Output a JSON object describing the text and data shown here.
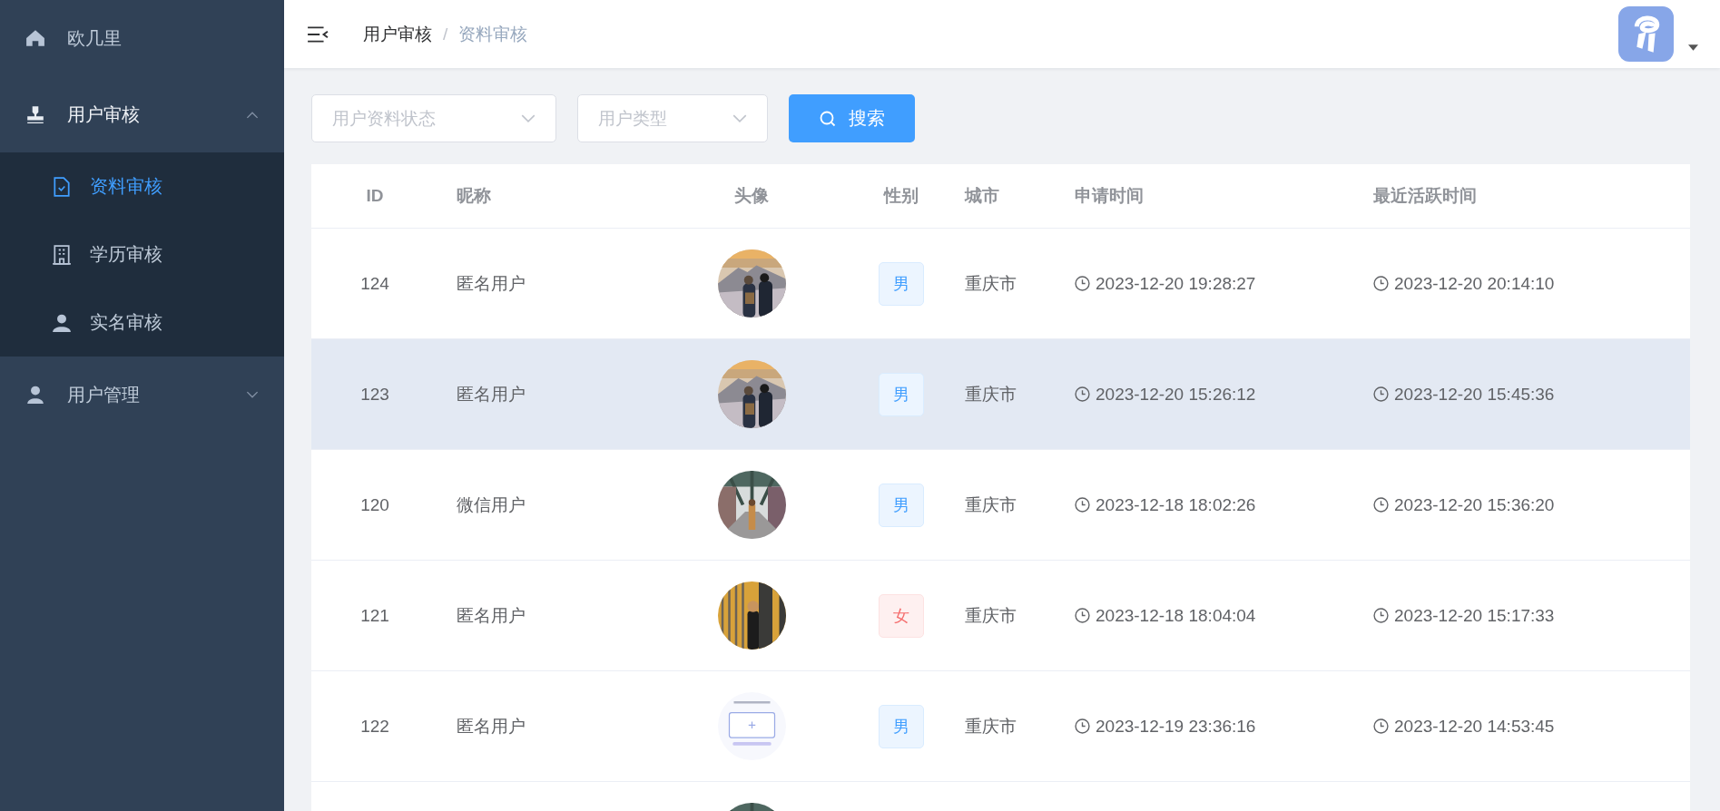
{
  "sidebar": {
    "items": [
      {
        "label": "欧几里"
      },
      {
        "label": "用户审核",
        "expanded": true,
        "children": [
          {
            "label": "资料审核",
            "selected": true
          },
          {
            "label": "学历审核",
            "selected": false
          },
          {
            "label": "实名审核",
            "selected": false
          }
        ]
      },
      {
        "label": "用户管理",
        "expanded": false
      }
    ]
  },
  "header": {
    "breadcrumb": [
      {
        "label": "用户审核",
        "current": false
      },
      {
        "label": "资料审核",
        "current": true
      }
    ],
    "separator": "/"
  },
  "filters": {
    "selects": [
      {
        "placeholder": "用户资料状态"
      },
      {
        "placeholder": "用户类型"
      }
    ],
    "search_button": "搜索"
  },
  "table": {
    "columns": [
      "ID",
      "昵称",
      "头像",
      "性别",
      "城市",
      "申请时间",
      "最近活跃时间"
    ],
    "rows": [
      {
        "id": "124",
        "nickname": "匿名用户",
        "gender": "男",
        "color": "#409eff",
        "city": "重庆市",
        "applied": "2023-12-20 19:28:27",
        "active": "2023-12-20 20:14:10",
        "selected": false
      },
      {
        "id": "123",
        "nickname": "匿名用户",
        "gender": "男",
        "color": "#409eff",
        "city": "重庆市",
        "applied": "2023-12-20 15:26:12",
        "active": "2023-12-20 15:45:36",
        "selected": true
      },
      {
        "id": "120",
        "nickname": "微信用户",
        "gender": "男",
        "color": "#409eff",
        "city": "重庆市",
        "applied": "2023-12-18 18:02:26",
        "active": "2023-12-20 15:36:20",
        "selected": false
      },
      {
        "id": "121",
        "nickname": "匿名用户",
        "gender": "女",
        "color": "#f56c6c",
        "city": "重庆市",
        "applied": "2023-12-18 18:04:04",
        "active": "2023-12-20 15:17:33",
        "selected": false
      },
      {
        "id": "122",
        "nickname": "匿名用户",
        "gender": "男",
        "color": "#409eff",
        "city": "重庆市",
        "applied": "2023-12-19 23:36:16",
        "active": "2023-12-20 14:53:45",
        "selected": false
      },
      {
        "selected": false
      }
    ]
  }
}
